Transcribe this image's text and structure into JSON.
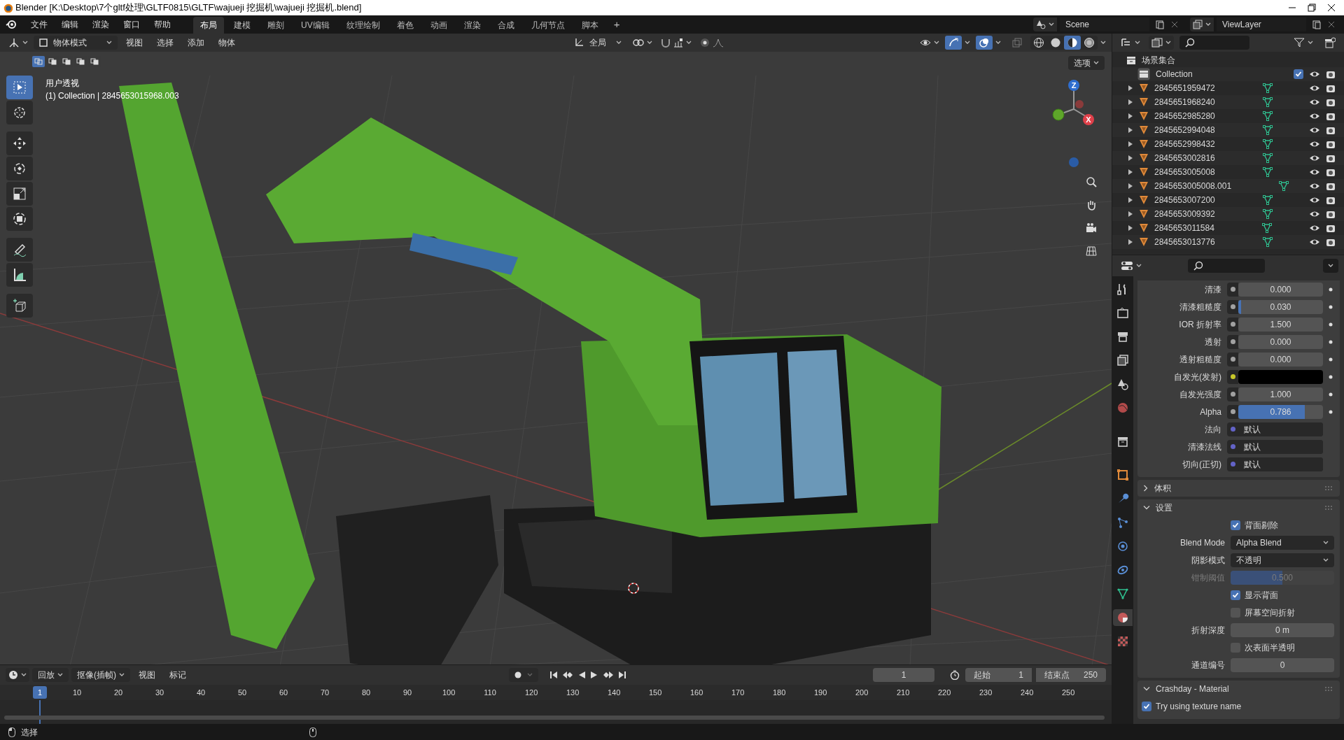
{
  "title_bar": {
    "title": "Blender [K:\\Desktop\\7个gltf处理\\GLTF0815\\GLTF\\wajueji  挖掘机\\wajueji  挖掘机.blend]"
  },
  "menu": [
    "文件",
    "编辑",
    "渲染",
    "窗口",
    "帮助"
  ],
  "workspaces": [
    {
      "label": "布局",
      "selected": true
    },
    {
      "label": "建模",
      "selected": false
    },
    {
      "label": "雕刻",
      "selected": false
    },
    {
      "label": "UV编辑",
      "selected": false
    },
    {
      "label": "纹理绘制",
      "selected": false
    },
    {
      "label": "着色",
      "selected": false
    },
    {
      "label": "动画",
      "selected": false
    },
    {
      "label": "渲染",
      "selected": false
    },
    {
      "label": "合成",
      "selected": false
    },
    {
      "label": "几何节点",
      "selected": false
    },
    {
      "label": "脚本",
      "selected": false
    }
  ],
  "add_workspace": "+",
  "scene": "Scene",
  "view_layer": "ViewLayer",
  "viewport": {
    "mode": "物体模式",
    "menus": [
      "视图",
      "选择",
      "添加",
      "物体"
    ],
    "orientation": "全局",
    "options": "选项",
    "view_name": "用户透视",
    "object_info": "(1) Collection | 2845653015968.003",
    "gizmo": {
      "z": "Z",
      "x": "X"
    },
    "shading": [
      {
        "kind": "wireframe",
        "selected": false
      },
      {
        "kind": "solid",
        "selected": false
      },
      {
        "kind": "material",
        "selected": true
      },
      {
        "kind": "rendered",
        "selected": false
      }
    ],
    "tools": [
      {
        "kind": "select",
        "selected": true
      },
      {
        "kind": "cursor",
        "selected": false
      },
      {
        "kind": "move",
        "selected": false
      },
      {
        "kind": "rotate",
        "selected": false
      },
      {
        "kind": "scale",
        "selected": false
      },
      {
        "kind": "transform",
        "selected": false
      },
      {
        "kind": "annotate",
        "selected": false
      },
      {
        "kind": "measure",
        "selected": false
      },
      {
        "kind": "add_cube",
        "selected": false
      }
    ]
  },
  "outliner": {
    "scene_collection": "场景集合",
    "collection": {
      "name": "Collection",
      "checked": true
    },
    "objects": [
      {
        "name": "2845651959472",
        "expanded": false
      },
      {
        "name": "2845651968240",
        "expanded": false
      },
      {
        "name": "2845652985280",
        "expanded": false
      },
      {
        "name": "2845652994048",
        "expanded": false
      },
      {
        "name": "2845652998432",
        "expanded": false
      },
      {
        "name": "2845653002816",
        "expanded": false
      },
      {
        "name": "2845653005008",
        "expanded": false
      },
      {
        "name": "2845653005008.001",
        "expanded": false
      },
      {
        "name": "2845653007200",
        "expanded": false
      },
      {
        "name": "2845653009392",
        "expanded": false
      },
      {
        "name": "2845653011584",
        "expanded": false
      },
      {
        "name": "2845653013776",
        "expanded": false
      }
    ]
  },
  "properties": {
    "tabs": [
      {
        "kind": "tool",
        "selected": false
      },
      {
        "kind": "render",
        "selected": false
      },
      {
        "kind": "output",
        "selected": false
      },
      {
        "kind": "view_layer",
        "selected": false
      },
      {
        "kind": "scene",
        "selected": false
      },
      {
        "kind": "world",
        "selected": false
      },
      {
        "kind": "collection",
        "selected": false
      },
      {
        "kind": "object",
        "selected": false
      },
      {
        "kind": "modifier",
        "selected": false
      },
      {
        "kind": "particles",
        "selected": false
      },
      {
        "kind": "physics",
        "selected": false
      },
      {
        "kind": "constraints",
        "selected": false
      },
      {
        "kind": "data",
        "selected": false
      },
      {
        "kind": "material",
        "selected": true
      },
      {
        "kind": "texture",
        "selected": false
      }
    ],
    "inputs": [
      {
        "kind": "slider",
        "label": "清漆",
        "value": "0.000",
        "level": 0,
        "color": "#a1a1a1"
      },
      {
        "kind": "slider",
        "label": "清漆粗糙度",
        "value": "0.030",
        "level": 0.03,
        "color": "#a1a1a1"
      },
      {
        "kind": "number",
        "label": "IOR 折射率",
        "value": "1.500",
        "color": "#a1a1a1"
      },
      {
        "kind": "slider",
        "label": "透射",
        "value": "0.000",
        "level": 0,
        "color": "#a1a1a1"
      },
      {
        "kind": "slider",
        "label": "透射粗糙度",
        "value": "0.000",
        "level": 0,
        "color": "#a1a1a1"
      },
      {
        "kind": "color",
        "label": "自发光(发射)",
        "color": "#c7c729"
      },
      {
        "kind": "number",
        "label": "自发光强度",
        "value": "1.000",
        "color": "#a1a1a1"
      },
      {
        "kind": "slider",
        "label": "Alpha",
        "value": "0.786",
        "level": 0.786,
        "color": "#a1a1a1"
      },
      {
        "kind": "link",
        "label": "法向",
        "value": "默认",
        "color": "#6363c7"
      },
      {
        "kind": "link",
        "label": "清漆法线",
        "value": "默认",
        "color": "#6363c7"
      },
      {
        "kind": "link",
        "label": "切向(正切)",
        "value": "默认",
        "color": "#6363c7"
      }
    ],
    "panels": [
      {
        "title": "体积",
        "expanded": false
      },
      {
        "title": "设置",
        "expanded": true,
        "rows": [
          {
            "kind": "checkbox",
            "label": "背面剔除",
            "checked": true
          },
          {
            "kind": "dropdown",
            "label": "Blend Mode",
            "value": "Alpha Blend"
          },
          {
            "kind": "dropdown",
            "label": "阴影模式",
            "value": "不透明"
          },
          {
            "kind": "slider",
            "label": "钳制阈值",
            "value": "0.500",
            "level": 0.5,
            "disabled": true
          },
          {
            "kind": "checkbox",
            "label": "显示背面",
            "checked": true
          },
          {
            "kind": "checkbox",
            "label": "屏幕空间折射",
            "checked": false
          },
          {
            "kind": "number",
            "label": "折射深度",
            "value": "0 m"
          },
          {
            "kind": "checkbox",
            "label": "次表面半透明",
            "checked": false
          },
          {
            "kind": "number",
            "label": "通道编号",
            "value": "0"
          }
        ]
      },
      {
        "title": "Crashday - Material",
        "expanded": true,
        "rows": [
          {
            "kind": "wide_checkbox",
            "label": "Try using texture name",
            "checked": true
          }
        ]
      }
    ]
  },
  "timeline": {
    "menus": [
      "回放",
      "抠像(插帧)",
      "视图",
      "标记"
    ],
    "current_frame": "1",
    "start_label": "起始",
    "start": "1",
    "end_label": "结束点",
    "end": "250",
    "playhead": "1",
    "ruler": [
      "10",
      "20",
      "30",
      "40",
      "50",
      "60",
      "70",
      "80",
      "90",
      "100",
      "110",
      "120",
      "130",
      "140",
      "150",
      "160",
      "170",
      "180",
      "190",
      "200",
      "210",
      "220",
      "230",
      "240",
      "250"
    ]
  },
  "status_bar": {
    "hint": "选择"
  }
}
